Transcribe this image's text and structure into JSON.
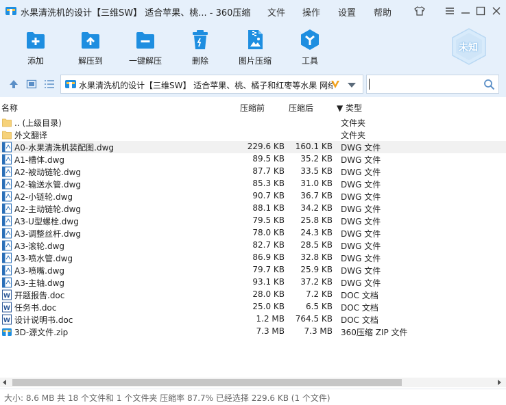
{
  "window": {
    "title": "水果清洗机的设计【三维SW】 适合苹果、桃... - 360压缩",
    "menu": [
      "文件",
      "操作",
      "设置",
      "帮助"
    ]
  },
  "toolbar": {
    "buttons": [
      {
        "label": "添加",
        "icon": "add-file-icon"
      },
      {
        "label": "解压到",
        "icon": "extract-to-icon"
      },
      {
        "label": "一键解压",
        "icon": "one-click-extract-icon"
      },
      {
        "label": "删除",
        "icon": "trash-icon"
      },
      {
        "label": "图片压缩",
        "icon": "image-compress-icon"
      },
      {
        "label": "工具",
        "icon": "tools-icon"
      }
    ],
    "badge_label": "未知"
  },
  "address": {
    "path": "水果清洗机的设计【三维SW】 适合苹果、桃、橘子和红枣等水果 网络",
    "search_value": ""
  },
  "columns": {
    "name": "名称",
    "size": "压缩前",
    "packed": "压缩后",
    "type": "▼ 类型"
  },
  "files": [
    {
      "name": ".. (上级目录)",
      "size": "",
      "packed": "",
      "type": "文件夹",
      "kind": "folder"
    },
    {
      "name": "外文翻译",
      "size": "",
      "packed": "",
      "type": "文件夹",
      "kind": "folder"
    },
    {
      "name": "A0-水果清洗机装配图.dwg",
      "size": "229.6 KB",
      "packed": "160.1 KB",
      "type": "DWG 文件",
      "kind": "dwg",
      "selected": true
    },
    {
      "name": "A1-槽体.dwg",
      "size": "89.5 KB",
      "packed": "35.2 KB",
      "type": "DWG 文件",
      "kind": "dwg"
    },
    {
      "name": "A2-被动链轮.dwg",
      "size": "87.7 KB",
      "packed": "33.5 KB",
      "type": "DWG 文件",
      "kind": "dwg"
    },
    {
      "name": "A2-输送水管.dwg",
      "size": "85.3 KB",
      "packed": "31.0 KB",
      "type": "DWG 文件",
      "kind": "dwg"
    },
    {
      "name": "A2-小链轮.dwg",
      "size": "90.7 KB",
      "packed": "36.7 KB",
      "type": "DWG 文件",
      "kind": "dwg"
    },
    {
      "name": "A2-主动链轮.dwg",
      "size": "88.1 KB",
      "packed": "34.2 KB",
      "type": "DWG 文件",
      "kind": "dwg"
    },
    {
      "name": "A3-U型螺栓.dwg",
      "size": "79.5 KB",
      "packed": "25.8 KB",
      "type": "DWG 文件",
      "kind": "dwg"
    },
    {
      "name": "A3-调整丝杆.dwg",
      "size": "78.0 KB",
      "packed": "24.3 KB",
      "type": "DWG 文件",
      "kind": "dwg"
    },
    {
      "name": "A3-滚轮.dwg",
      "size": "82.7 KB",
      "packed": "28.5 KB",
      "type": "DWG 文件",
      "kind": "dwg"
    },
    {
      "name": "A3-喷水管.dwg",
      "size": "86.9 KB",
      "packed": "32.8 KB",
      "type": "DWG 文件",
      "kind": "dwg"
    },
    {
      "name": "A3-喷嘴.dwg",
      "size": "79.7 KB",
      "packed": "25.9 KB",
      "type": "DWG 文件",
      "kind": "dwg"
    },
    {
      "name": "A3-主轴.dwg",
      "size": "93.1 KB",
      "packed": "37.2 KB",
      "type": "DWG 文件",
      "kind": "dwg"
    },
    {
      "name": "开题报告.doc",
      "size": "28.0 KB",
      "packed": "7.2 KB",
      "type": "DOC 文档",
      "kind": "doc"
    },
    {
      "name": "任务书.doc",
      "size": "25.0 KB",
      "packed": "6.5 KB",
      "type": "DOC 文档",
      "kind": "doc"
    },
    {
      "name": "设计说明书.doc",
      "size": "1.2 MB",
      "packed": "764.5 KB",
      "type": "DOC 文档",
      "kind": "doc"
    },
    {
      "name": "3D-源文件.zip",
      "size": "7.3 MB",
      "packed": "7.3 MB",
      "type": "360压缩 ZIP 文件",
      "kind": "zip"
    }
  ],
  "status": {
    "text": "大小: 8.6 MB 共 18 个文件和 1 个文件夹 压缩率 87.7% 已经选择 229.6 KB (1 个文件)"
  },
  "colors": {
    "chrome": "#e6f0fb",
    "accent": "#1e8ee0",
    "folder": "#f6d27a",
    "selected_row": "#f1f1f1"
  }
}
